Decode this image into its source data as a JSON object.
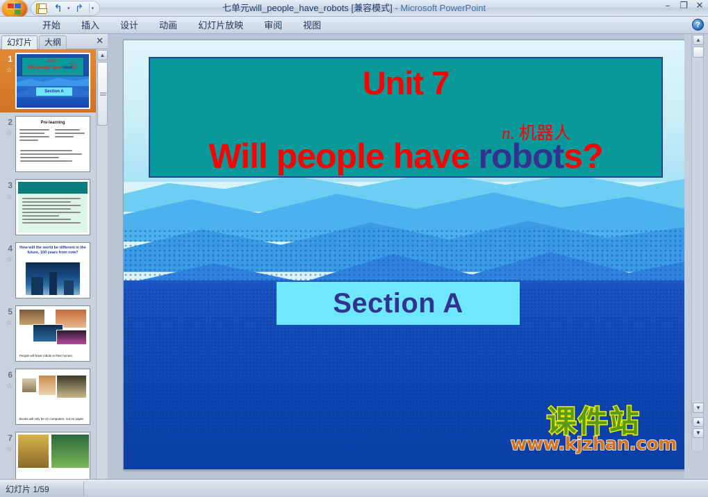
{
  "window": {
    "title_main": "七单元will_people_have_robots [兼容模式]",
    "title_sep": " - ",
    "title_app": "Microsoft PowerPoint",
    "minimize": "–",
    "restore": "❐",
    "close": "✕"
  },
  "quick_access": {
    "save": "save-icon",
    "undo": "↰",
    "undo_caret": "▾",
    "redo": "↱",
    "more_caret": "▾"
  },
  "ribbon": {
    "tabs": [
      {
        "label": "开始"
      },
      {
        "label": "插入"
      },
      {
        "label": "设计"
      },
      {
        "label": "动画"
      },
      {
        "label": "幻灯片放映"
      },
      {
        "label": "审阅"
      },
      {
        "label": "视图"
      }
    ],
    "help": "?"
  },
  "left_pane": {
    "tab_slides": "幻灯片",
    "tab_outline": "大纲",
    "close": "✕",
    "scroll_up": "▲",
    "thumbnails": [
      {
        "num": "1",
        "star": "☆",
        "kind": "title"
      },
      {
        "num": "2",
        "star": "☆",
        "kind": "prelearning",
        "title": "Pre-learning"
      },
      {
        "num": "3",
        "star": "☆",
        "kind": "quiz"
      },
      {
        "num": "4",
        "star": "☆",
        "kind": "future",
        "title": "How will the world be different in the future, 100 years from now?"
      },
      {
        "num": "5",
        "star": "☆",
        "kind": "robots",
        "caption": "People will have robots in their homes."
      },
      {
        "num": "6",
        "star": "☆",
        "kind": "books",
        "caption": "Books will only be on computers, not on paper."
      },
      {
        "num": "7",
        "star": "☆",
        "kind": "market"
      }
    ]
  },
  "slide": {
    "unit": "Unit 7",
    "gloss_pos": "n.",
    "gloss_cn": "机器人",
    "question_pre": "Will people have ",
    "question_hl": "robot",
    "question_post": "s?",
    "section": "Section A",
    "watermark_cn": "课件站",
    "watermark_url": "www.kjzhan.com"
  },
  "vscroll": {
    "up": "▲",
    "down": "▼",
    "prev_slide": "▲",
    "next_slide": "▼"
  },
  "status": {
    "slide_count": "幻灯片 1/59"
  },
  "colors": {
    "title_box": "#089a9a",
    "title_text_red": "#ff0000",
    "highlight_purple": "#33338f",
    "section_box": "#6fe7ff",
    "watermark_green": "#5a9a10",
    "watermark_yellow": "#f5f000",
    "watermark_orange": "#d4731c",
    "selection_orange": "#d97c26"
  }
}
